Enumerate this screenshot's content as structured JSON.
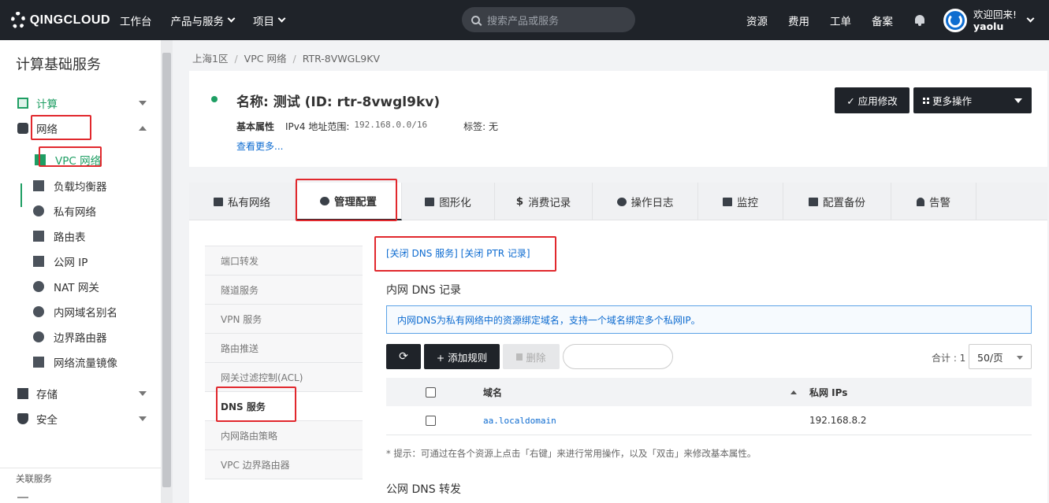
{
  "topbar": {
    "logo_text": "QINGCLOUD",
    "nav": [
      "工作台",
      "产品与服务",
      "项目"
    ],
    "search_placeholder": "搜索产品或服务",
    "right_items": [
      "资源",
      "费用",
      "工单",
      "备案"
    ],
    "welcome": "欢迎回来!",
    "username": "yaolu"
  },
  "sidebar": {
    "title": "计算基础服务",
    "groups": [
      {
        "label": "计算"
      },
      {
        "label": "网络"
      },
      {
        "label": "存储"
      },
      {
        "label": "安全"
      }
    ],
    "network_items": [
      {
        "label": "VPC 网络",
        "icon": "vpc-icon"
      },
      {
        "label": "负载均衡器",
        "icon": "load-balancer-icon"
      },
      {
        "label": "私有网络",
        "icon": "private-network-icon"
      },
      {
        "label": "路由表",
        "icon": "route-table-icon"
      },
      {
        "label": "公网 IP",
        "icon": "ip-icon"
      },
      {
        "label": "NAT 网关",
        "icon": "nat-icon"
      },
      {
        "label": "内网域名别名",
        "icon": "domain-alias-icon"
      },
      {
        "label": "边界路由器",
        "icon": "border-router-icon"
      },
      {
        "label": "网络流量镜像",
        "icon": "traffic-mirror-icon"
      }
    ],
    "footer": "关联服务"
  },
  "breadcrumb": [
    "上海1区",
    "VPC 网络",
    "RTR-8VWGL9KV"
  ],
  "resource": {
    "title": "名称: 测试 (ID: rtr-8vwgl9kv)",
    "basic_label": "基本属性",
    "ipv4_label": "IPv4 地址范围:",
    "ipv4_value": "192.168.0.0/16",
    "tag_label": "标签: 无",
    "more_link": "查看更多...",
    "apply_button": "✓ 应用修改",
    "more_ops_button": "更多操作"
  },
  "tabs": [
    "私有网络",
    "管理配置",
    "图形化",
    "消费记录",
    "操作日志",
    "监控",
    "配置备份",
    "告警"
  ],
  "subnav": [
    "端口转发",
    "隧道服务",
    "VPN 服务",
    "路由推送",
    "网关过滤控制(ACL)",
    "DNS 服务",
    "内网路由策略",
    "VPC 边界路由器"
  ],
  "dns": {
    "links": "[关闭 DNS 服务]  [关闭 PTR 记录]",
    "internal_title": "内网 DNS 记录",
    "info": "内网DNS为私有网络中的资源绑定域名，支持一个域名绑定多个私网IP。",
    "add_button": "+ 添加规则",
    "delete_button": "删除",
    "total": "合计 : 1",
    "per_page": "50/页",
    "columns": [
      "域名",
      "私网 IPs"
    ],
    "rows": [
      {
        "domain": "aa.localdomain",
        "ips": "192.168.8.2"
      }
    ],
    "hint": "* 提示：可通过在各个资源上点击「右键」来进行常用操作，以及「双击」来修改基本属性。",
    "public_title": "公网 DNS 转发"
  },
  "colors": {
    "accent": "#1e9e63",
    "dark": "#1f2329",
    "link": "#0d6bd0",
    "highlight": "#e1282d"
  }
}
